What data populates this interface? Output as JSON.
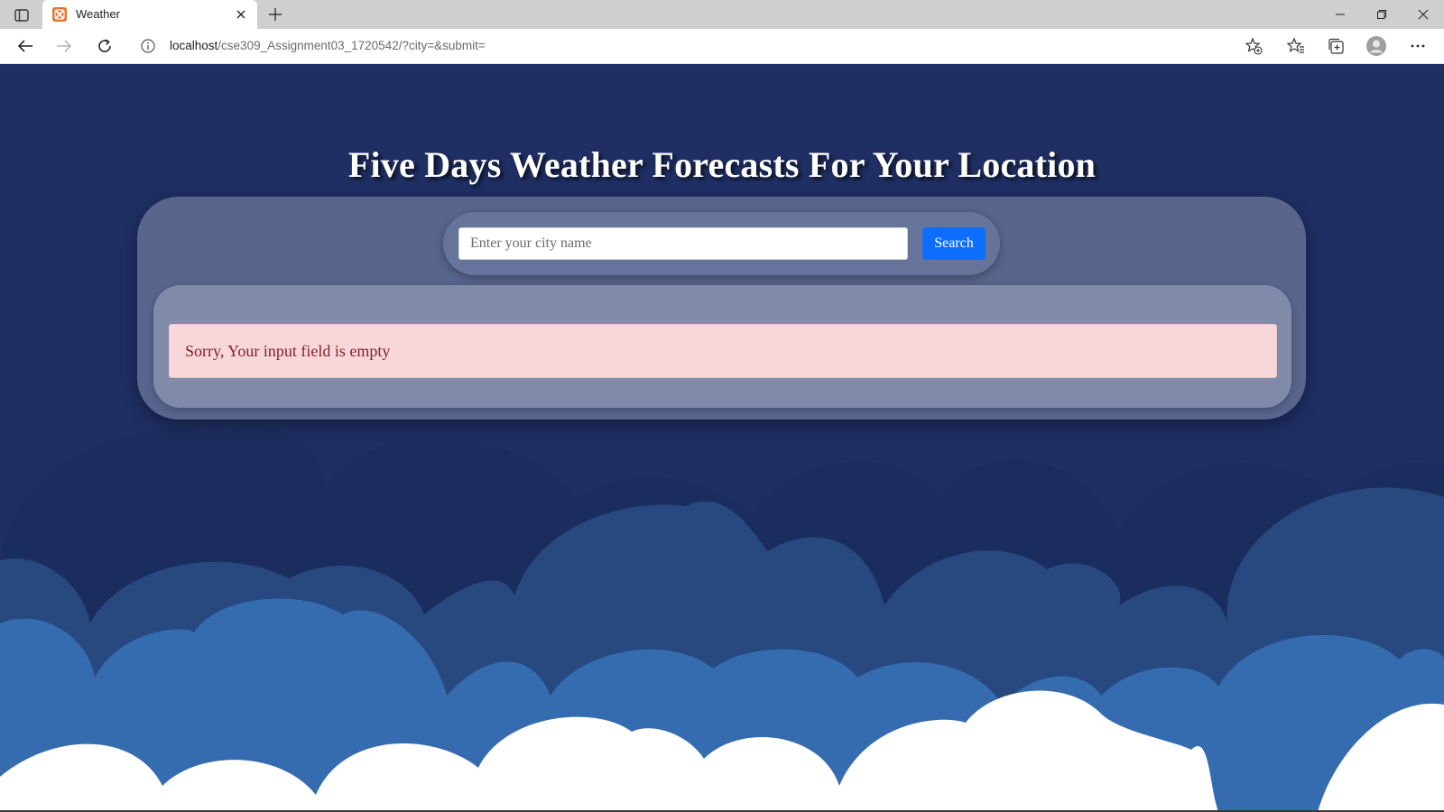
{
  "browser": {
    "tab_title": "Weather",
    "url_host": "localhost",
    "url_path": "/cse309_Assignment03_1720542/?city=&submit=",
    "icons": {
      "tab_actions": "tab-actions-icon",
      "favicon": "xampp-favicon",
      "close_tab": "close-icon",
      "new_tab": "plus-icon",
      "minimize": "minimize-icon",
      "restore": "restore-icon",
      "close_window": "close-icon",
      "back": "back-arrow-icon",
      "forward": "forward-arrow-icon",
      "refresh": "refresh-icon",
      "site_info": "info-icon",
      "add_favorite": "star-plus-icon",
      "favorites": "favorites-icon",
      "collections": "collections-icon",
      "profile": "avatar-icon",
      "more": "more-icon"
    }
  },
  "page": {
    "heading": "Five Days Weather Forecasts For Your Location",
    "search": {
      "placeholder": "Enter your city name",
      "value": "",
      "button_label": "Search"
    },
    "alert_message": "Sorry, Your input field is empty"
  },
  "colors": {
    "page_background": "#1f2f63",
    "card": "#58658d",
    "search_pill": "#66739a",
    "result_box": "#808aa9",
    "search_button": "#0d6efd",
    "alert_background": "#f8d7da",
    "alert_text": "#842029",
    "cloud_dark": "#1b2d5e",
    "cloud_mid": "#27497f",
    "cloud_light": "#356cb0",
    "cloud_white": "#ffffff"
  }
}
